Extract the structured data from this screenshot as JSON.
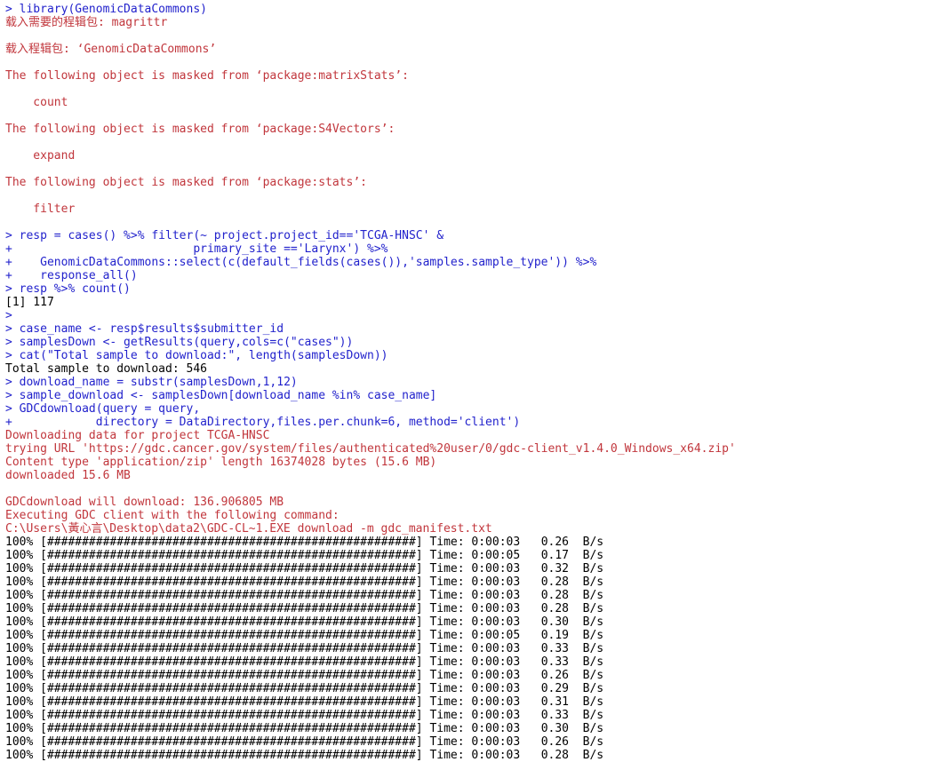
{
  "window": {
    "app": "R Console",
    "background": "#ffffff",
    "colors": {
      "input": "#2222cc",
      "message": "#c1363c",
      "output": "#000000"
    }
  },
  "console": {
    "lines": [
      {
        "kind": "input",
        "text": "> library(GenomicDataCommons)"
      },
      {
        "kind": "message",
        "text": "载入需要的程辑包: magrittr"
      },
      {
        "kind": "blank",
        "text": ""
      },
      {
        "kind": "message",
        "text": "载入程辑包: ‘GenomicDataCommons’"
      },
      {
        "kind": "blank",
        "text": ""
      },
      {
        "kind": "message",
        "text": "The following object is masked from ‘package:matrixStats’:"
      },
      {
        "kind": "blank",
        "text": ""
      },
      {
        "kind": "message",
        "text": "    count"
      },
      {
        "kind": "blank",
        "text": ""
      },
      {
        "kind": "message",
        "text": "The following object is masked from ‘package:S4Vectors’:"
      },
      {
        "kind": "blank",
        "text": ""
      },
      {
        "kind": "message",
        "text": "    expand"
      },
      {
        "kind": "blank",
        "text": ""
      },
      {
        "kind": "message",
        "text": "The following object is masked from ‘package:stats’:"
      },
      {
        "kind": "blank",
        "text": ""
      },
      {
        "kind": "message",
        "text": "    filter"
      },
      {
        "kind": "blank",
        "text": ""
      },
      {
        "kind": "input",
        "text": "> resp = cases() %>% filter(~ project.project_id=='TCGA-HNSC' &"
      },
      {
        "kind": "input",
        "text": "+                          primary_site =='Larynx') %>%"
      },
      {
        "kind": "input",
        "text": "+    GenomicDataCommons::select(c(default_fields(cases()),'samples.sample_type')) %>%"
      },
      {
        "kind": "input",
        "text": "+    response_all()"
      },
      {
        "kind": "input",
        "text": "> resp %>% count()"
      },
      {
        "kind": "output",
        "text": "[1] 117"
      },
      {
        "kind": "input",
        "text": ">"
      },
      {
        "kind": "input",
        "text": "> case_name <- resp$results$submitter_id"
      },
      {
        "kind": "input",
        "text": "> samplesDown <- getResults(query,cols=c(\"cases\"))"
      },
      {
        "kind": "input",
        "text": "> cat(\"Total sample to download:\", length(samplesDown))"
      },
      {
        "kind": "output",
        "text": "Total sample to download: 546"
      },
      {
        "kind": "input",
        "text": "> download_name = substr(samplesDown,1,12)"
      },
      {
        "kind": "input",
        "text": "> sample_download <- samplesDown[download_name %in% case_name]"
      },
      {
        "kind": "input",
        "text": "> GDCdownload(query = query,"
      },
      {
        "kind": "input",
        "text": "+            directory = DataDirectory,files.per.chunk=6, method='client')"
      },
      {
        "kind": "message",
        "text": "Downloading data for project TCGA-HNSC"
      },
      {
        "kind": "message",
        "text": "trying URL 'https://gdc.cancer.gov/system/files/authenticated%20user/0/gdc-client_v1.4.0_Windows_x64.zip'"
      },
      {
        "kind": "message",
        "text": "Content type 'application/zip' length 16374028 bytes (15.6 MB)"
      },
      {
        "kind": "message",
        "text": "downloaded 15.6 MB"
      },
      {
        "kind": "blank",
        "text": ""
      },
      {
        "kind": "message",
        "text": "GDCdownload will download: 136.906805 MB"
      },
      {
        "kind": "message",
        "text": "Executing GDC client with the following command:"
      },
      {
        "kind": "message",
        "text": "C:\\Users\\黃心言\\Desktop\\data2\\GDC-CL~1.EXE download -m gdc_manifest.txt"
      }
    ],
    "progress_bar": {
      "percent_label": "100%",
      "bar_open": "[",
      "bar_fill_char": "#",
      "bar_fill_count": 53,
      "bar_close": "]",
      "time_label": "Time:",
      "rate_unit": "B/s",
      "rows": [
        {
          "percent": "100%",
          "time": "0:00:03",
          "rate": "0.26",
          "unit": "B/s"
        },
        {
          "percent": "100%",
          "time": "0:00:05",
          "rate": "0.17",
          "unit": "B/s"
        },
        {
          "percent": "100%",
          "time": "0:00:03",
          "rate": "0.32",
          "unit": "B/s"
        },
        {
          "percent": "100%",
          "time": "0:00:03",
          "rate": "0.28",
          "unit": "B/s"
        },
        {
          "percent": "100%",
          "time": "0:00:03",
          "rate": "0.28",
          "unit": "B/s"
        },
        {
          "percent": "100%",
          "time": "0:00:03",
          "rate": "0.28",
          "unit": "B/s"
        },
        {
          "percent": "100%",
          "time": "0:00:03",
          "rate": "0.30",
          "unit": "B/s"
        },
        {
          "percent": "100%",
          "time": "0:00:05",
          "rate": "0.19",
          "unit": "B/s"
        },
        {
          "percent": "100%",
          "time": "0:00:03",
          "rate": "0.33",
          "unit": "B/s"
        },
        {
          "percent": "100%",
          "time": "0:00:03",
          "rate": "0.33",
          "unit": "B/s"
        },
        {
          "percent": "100%",
          "time": "0:00:03",
          "rate": "0.26",
          "unit": "B/s"
        },
        {
          "percent": "100%",
          "time": "0:00:03",
          "rate": "0.29",
          "unit": "B/s"
        },
        {
          "percent": "100%",
          "time": "0:00:03",
          "rate": "0.31",
          "unit": "B/s"
        },
        {
          "percent": "100%",
          "time": "0:00:03",
          "rate": "0.33",
          "unit": "B/s"
        },
        {
          "percent": "100%",
          "time": "0:00:03",
          "rate": "0.30",
          "unit": "B/s"
        },
        {
          "percent": "100%",
          "time": "0:00:03",
          "rate": "0.26",
          "unit": "B/s"
        },
        {
          "percent": "100%",
          "time": "0:00:03",
          "rate": "0.28",
          "unit": "B/s"
        }
      ]
    }
  }
}
